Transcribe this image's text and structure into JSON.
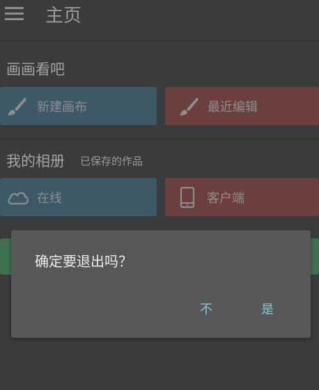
{
  "header": {
    "menu_icon": "hamburger-menu-icon",
    "title": "主页"
  },
  "draw_section": {
    "title": "画画看吧",
    "new_canvas": {
      "label": "新建画布",
      "icon": "brush-icon",
      "color": "#3d5866"
    },
    "recent_edit": {
      "label": "最近编辑",
      "icon": "brush-icon",
      "color": "#6a3f3e"
    }
  },
  "album_section": {
    "title": "我的相册",
    "subtitle": "已保存的作品",
    "online": {
      "label": "在线",
      "icon": "cloud-icon",
      "color": "#3d5866"
    },
    "client": {
      "label": "客户端",
      "icon": "phone-icon",
      "color": "#6a3f3e"
    }
  },
  "hidden_card_color": "#3f7050",
  "dialog": {
    "message": "确定要退出吗？",
    "no_label": "不",
    "yes_label": "是",
    "button_color": "#84c8d8"
  }
}
